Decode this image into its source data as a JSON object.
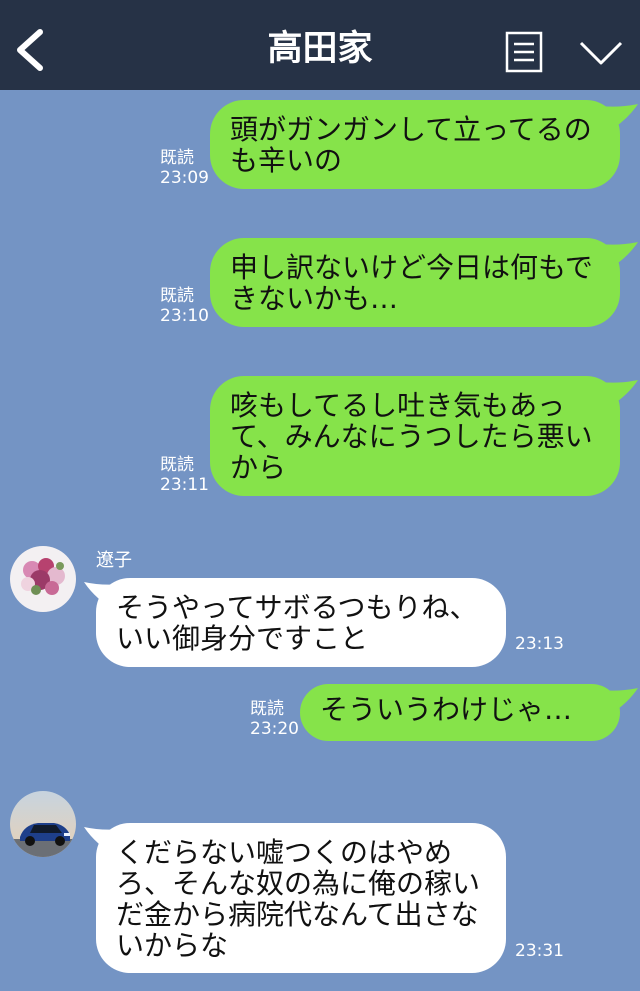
{
  "header": {
    "title": "高田家",
    "back_icon": "chevron-left-icon",
    "menu_icon": "note-icon",
    "expand_icon": "chevron-down-icon"
  },
  "colors": {
    "background": "#7494c4",
    "header": "#263246",
    "outgoing_bubble": "#86e34a",
    "incoming_bubble": "#ffffff"
  },
  "messages": [
    {
      "dir": "out",
      "read": "既読",
      "time": "23:09",
      "text": "頭がガンガンして立ってるのも辛いの"
    },
    {
      "dir": "out",
      "read": "既読",
      "time": "23:10",
      "text": "申し訳ないけど今日は何もできないかも…"
    },
    {
      "dir": "out",
      "read": "既読",
      "time": "23:11",
      "text": "咳もしてるし吐き気もあって、みんなにうつしたら悪いから"
    },
    {
      "dir": "in",
      "sender": "遼子",
      "time": "23:13",
      "text": "そうやってサボるつもりね、いい御身分ですこと"
    },
    {
      "dir": "out",
      "read": "既読",
      "time": "23:20",
      "text": "そういうわけじゃ…"
    },
    {
      "dir": "in",
      "sender": "",
      "time": "23:31",
      "text": "くだらない嘘つくのはやめろ、そんな奴の為に俺の稼いだ金から病院代なんて出さないからな"
    }
  ]
}
